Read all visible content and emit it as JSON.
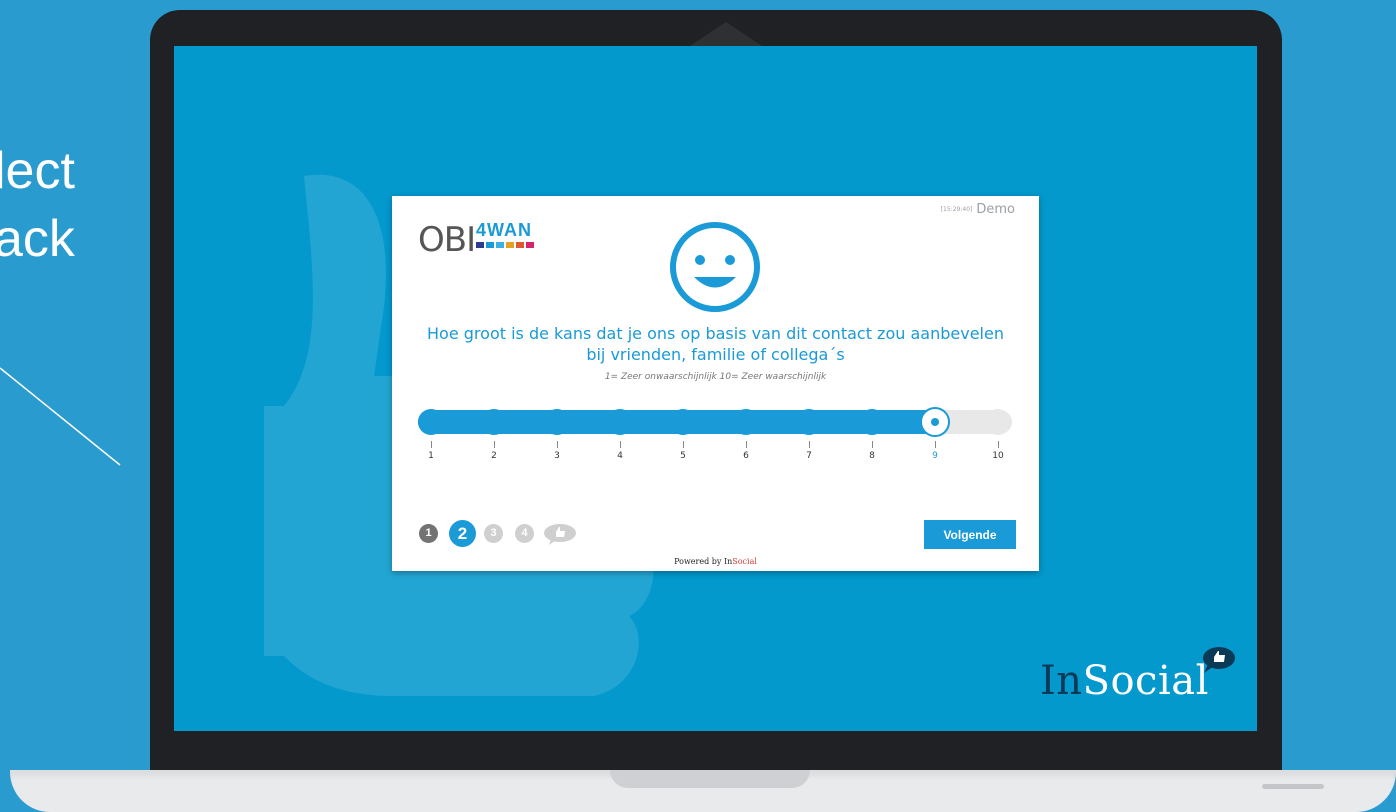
{
  "background": {
    "line1": "lect",
    "line2": "ack"
  },
  "colors": {
    "accent": "#1a9ad6",
    "screen": "#0399cd",
    "background": "#2a9bcf"
  },
  "survey": {
    "logo": {
      "prefix": "OBI",
      "suffix": "4WAN",
      "squares": [
        "#2d3c8e",
        "#1a9ad6",
        "#3ab1e0",
        "#e3a224",
        "#de5a2c",
        "#d5256d"
      ]
    },
    "demo": {
      "timestamp": "[15:29:40]",
      "label": "Demo"
    },
    "face_icon": "smiley-face-icon",
    "question_line1": "Hoe groot is de kans dat je ons op basis van dit contact zou aanbevelen",
    "question_line2": "bij vrienden, familie of collega´s",
    "hint": "1= Zeer onwaarschijnlijk 10= Zeer waarschijnlijk",
    "scale": {
      "min": 1,
      "max": 10,
      "selected": 9,
      "labels": [
        "1",
        "2",
        "3",
        "4",
        "5",
        "6",
        "7",
        "8",
        "9",
        "10"
      ]
    },
    "steps": {
      "labels": [
        "1",
        "2",
        "3",
        "4"
      ],
      "current": 2,
      "final_icon": "thumbs-up-bubble-icon"
    },
    "next_label": "Volgende",
    "powered_prefix": "Powered by ",
    "powered_in": "In",
    "powered_brand": "Social"
  },
  "brand": {
    "in": "In",
    "social": "Social",
    "icon": "thumbs-up-bubble-icon"
  }
}
